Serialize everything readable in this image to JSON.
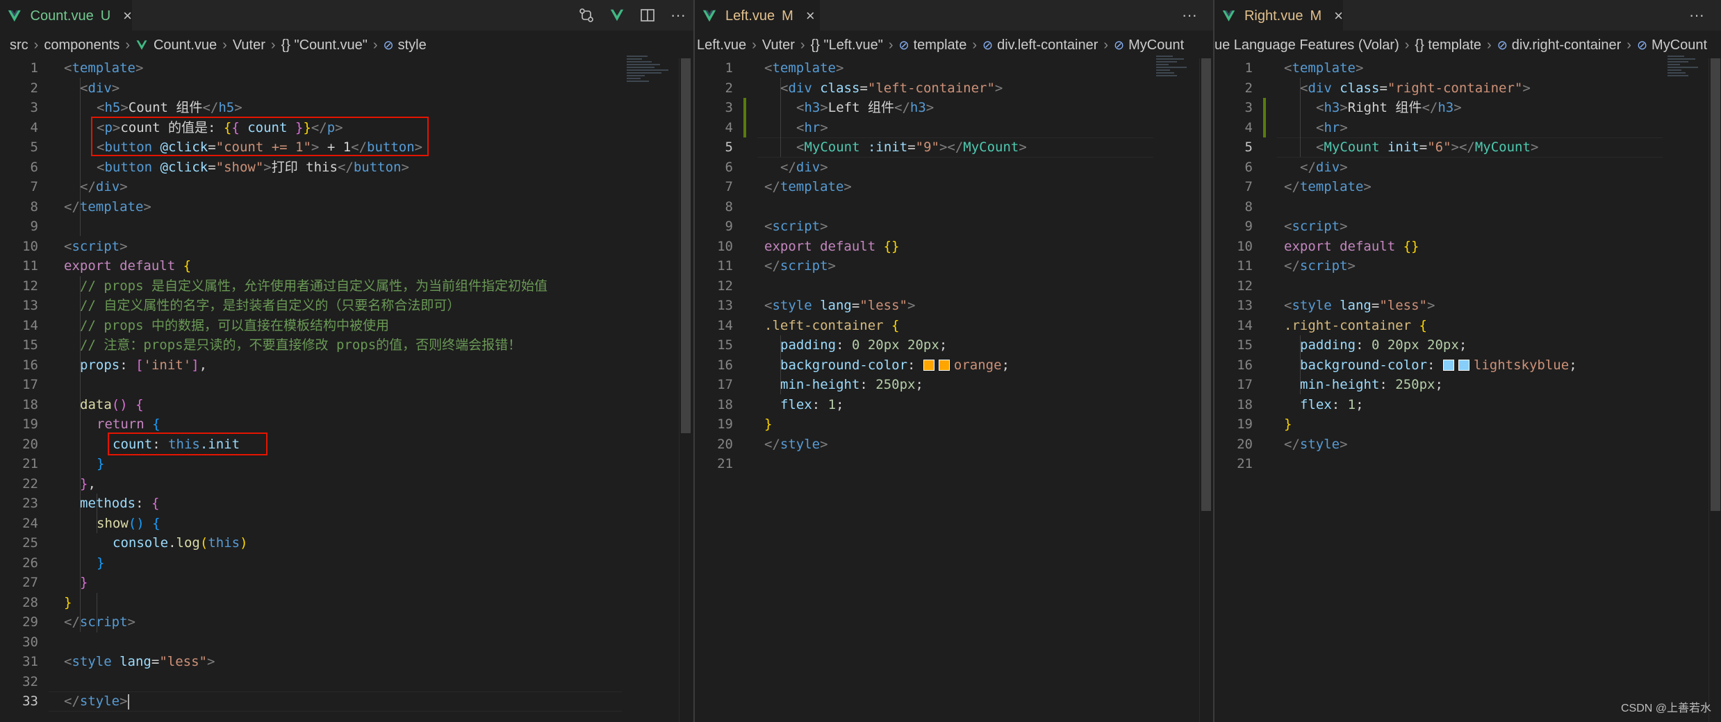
{
  "panes": [
    {
      "tab": {
        "filename": "Count.vue",
        "status": "U",
        "close_icon": "close-icon"
      },
      "actions": [
        "git-compare-icon",
        "vue-devtools-icon",
        "split-editor-icon",
        "more-actions-icon"
      ],
      "breadcrumb": [
        "src",
        "components",
        "Count.vue",
        "Vuter",
        "{} \"Count.vue\"",
        "style"
      ],
      "active_line": 33,
      "lines": [
        "1",
        "2",
        "3",
        "4",
        "5",
        "6",
        "7",
        "8",
        "9",
        "10",
        "11",
        "12",
        "13",
        "14",
        "15",
        "16",
        "17",
        "18",
        "19",
        "20",
        "21",
        "22",
        "23",
        "24",
        "25",
        "26",
        "27",
        "28",
        "29",
        "30",
        "31",
        "32",
        "33"
      ],
      "code": {
        "l3_text": "Count 组件",
        "l4_text1": "count 的值是: ",
        "l4_var": "count",
        "l5_attr": "@click",
        "l5_val": "\"count += 1\"",
        "l5_text": " + 1",
        "l6_attr": "@click",
        "l6_val": "\"show\"",
        "l6_text": "打印 this",
        "c12": "// props 是自定义属性，允许使用者通过自定义属性，为当前组件指定初始值",
        "c13": "// 自定义属性的名字，是封装者自定义的（只要名称合法即可）",
        "c14": "// props 中的数据，可以直接在模板结构中被使用",
        "c15": "// 注意：props是只读的，不要直接修改 props的值，否则终端会报错！",
        "l16_key": "props",
        "l16_val": "'init'",
        "l18_fn": "data",
        "l19_kw": "return",
        "l20_key": "count",
        "l20_this": "this",
        "l20_prop": ".init",
        "l23_key": "methods",
        "l24_fn": "show",
        "l25_obj": "console",
        "l25_fn": "log",
        "l25_arg": "this",
        "l31_lang": "\"less\""
      }
    },
    {
      "tab": {
        "filename": "Left.vue",
        "status": "M",
        "close_icon": "close-icon"
      },
      "actions": [
        "more-actions-icon"
      ],
      "breadcrumb": [
        "Left.vue",
        "Vuter",
        "{} \"Left.vue\"",
        "template",
        "div.left-container",
        "MyCount"
      ],
      "active_line": 5,
      "code": {
        "l2_class": "\"left-container\"",
        "l3_text": "Left 组件",
        "l5_attr": ":init",
        "l5_val": "\"9\"",
        "l14_sel": ".left-container",
        "l16_val": "orange",
        "l16_color": "#ffa500"
      }
    },
    {
      "tab": {
        "filename": "Right.vue",
        "status": "M",
        "close_icon": "close-icon"
      },
      "actions": [
        "more-actions-icon"
      ],
      "breadcrumb": [
        "ue Language Features (Volar)",
        "{} template",
        "div.right-container",
        "MyCount"
      ],
      "active_line": 5,
      "code": {
        "l2_class": "\"right-container\"",
        "l3_text": "Right 组件",
        "l5_attr": "init",
        "l5_val": "\"6\"",
        "l14_sel": ".right-container",
        "l16_val": "lightskyblue",
        "l16_color": "#87cefa"
      }
    }
  ],
  "common": {
    "template_tag": "template",
    "script_tag": "script",
    "style_tag": "style",
    "export_default": "export default",
    "padding_val": "0 20px 20px",
    "min_height_val": "250px",
    "flex_val": "1",
    "less": "\"less\"",
    "class_attr": "class",
    "lang_attr": "lang",
    "mycount": "MyCount"
  },
  "watermark": "CSDN @上善若水"
}
